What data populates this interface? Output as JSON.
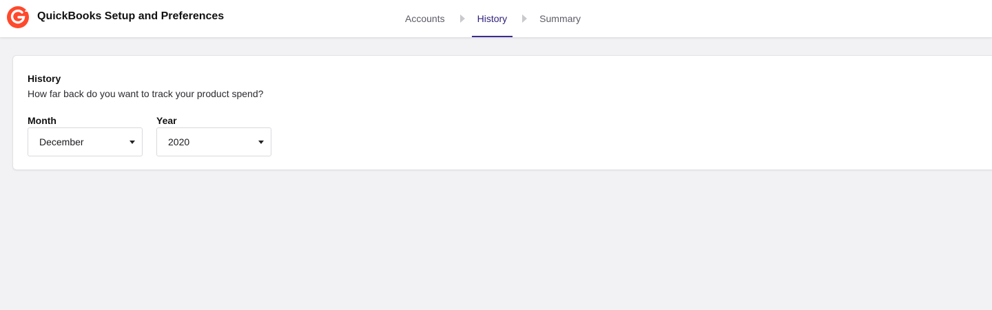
{
  "header": {
    "logo_icon": "g2-logo-icon",
    "title": "QuickBooks Setup and Preferences",
    "brand_color": "#ff492c",
    "steps": [
      {
        "label": "Accounts",
        "active": false
      },
      {
        "label": "History",
        "active": true
      },
      {
        "label": "Summary",
        "active": false
      }
    ],
    "active_color": "#2d1f7a"
  },
  "card": {
    "title": "History",
    "description": "How far back do you want to track your product spend?",
    "month": {
      "label": "Month",
      "value": "December"
    },
    "year": {
      "label": "Year",
      "value": "2020"
    }
  }
}
